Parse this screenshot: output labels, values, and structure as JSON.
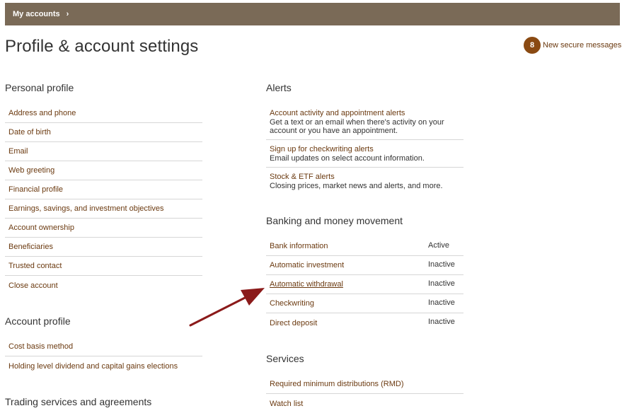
{
  "topbar": {
    "breadcrumb": "My accounts",
    "chevron": "›"
  },
  "title": "Profile & account settings",
  "messages": {
    "count": "8",
    "label": "New secure messages"
  },
  "personal_profile": {
    "title": "Personal profile",
    "items": [
      "Address and phone",
      "Date of birth",
      "Email",
      "Web greeting",
      "Financial profile",
      "Earnings, savings, and investment objectives",
      "Account ownership",
      "Beneficiaries",
      "Trusted contact",
      "Close account"
    ]
  },
  "account_profile": {
    "title": "Account profile",
    "items": [
      "Cost basis method",
      "Holding level dividend and capital gains elections"
    ]
  },
  "trading": {
    "title": "Trading services and agreements"
  },
  "alerts": {
    "title": "Alerts",
    "items": [
      {
        "label": "Account activity and appointment alerts",
        "desc": "Get a text or an email when there's activity on your account or you have an appointment."
      },
      {
        "label": "Sign up for checkwriting alerts",
        "desc": "Email updates on select account information."
      },
      {
        "label": "Stock & ETF alerts",
        "desc": "Closing prices, market news and alerts, and more."
      }
    ]
  },
  "banking": {
    "title": "Banking and money movement",
    "items": [
      {
        "label": "Bank information",
        "status": "Active"
      },
      {
        "label": "Automatic investment",
        "status": "Inactive"
      },
      {
        "label": "Automatic withdrawal",
        "status": "Inactive"
      },
      {
        "label": "Checkwriting",
        "status": "Inactive"
      },
      {
        "label": "Direct deposit",
        "status": "Inactive"
      }
    ]
  },
  "services": {
    "title": "Services",
    "items": [
      "Required minimum distributions (RMD)",
      "Watch list"
    ]
  },
  "colors": {
    "topbar": "#7a6a57",
    "link": "#6b3a10",
    "badge": "#8a4a12",
    "arrow": "#8b1a1a"
  }
}
